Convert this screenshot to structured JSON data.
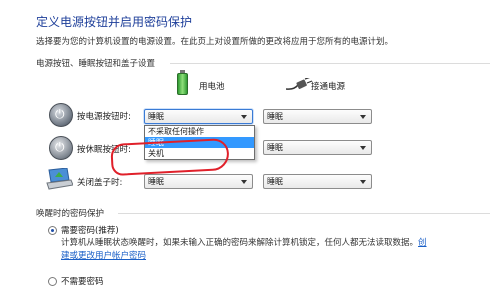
{
  "page": {
    "title": "定义电源按钮并启用密码保护",
    "description": "选择要为您的计算机设置的电源设置。在此页上对设置所做的更改将应用于您所有的电源计划。"
  },
  "buttons_section": {
    "heading": "电源按钮、睡眠按钮和盖子设置",
    "columns": {
      "battery": "用电池",
      "plugged": "接通电源"
    },
    "rows": [
      {
        "label": "按电源按钮时:",
        "battery_value": "睡眠",
        "plugged_value": "睡眠"
      },
      {
        "label": "按休眠按钮时:",
        "battery_value": "",
        "plugged_value": "睡眠"
      },
      {
        "label": "关闭盖子时:",
        "battery_value": "睡眠",
        "plugged_value": "睡眠"
      }
    ],
    "dropdown_options": [
      "不采取任何操作",
      "睡眠",
      "关机"
    ]
  },
  "password_section": {
    "heading": "唤醒时的密码保护",
    "require_label": "需要密码(推荐)",
    "require_desc": "计算机从睡眠状态唤醒时，如果未输入正确的密码来解除计算机锁定，任何人都无法读取数据。",
    "link_part1": "创",
    "link_part2": "建或更改用户帐户密码",
    "no_password_label": "不需要密码"
  },
  "colors": {
    "title": "#1e3f9a",
    "selection": "#3399ff",
    "annotation_circle": "#e0202a"
  },
  "icons": [
    "power-button-icon",
    "sleep-button-icon",
    "laptop-lid-icon",
    "battery-icon",
    "power-plug-icon"
  ]
}
